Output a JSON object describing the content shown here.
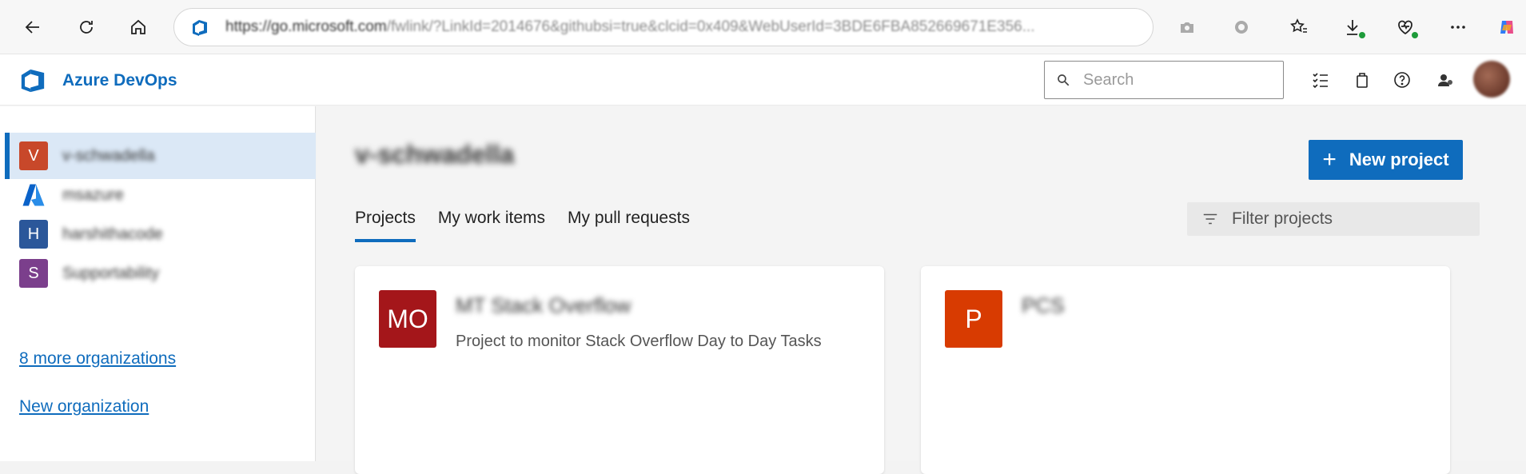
{
  "browser": {
    "url_host": "https://go.microsoft.com",
    "url_path": "/fwlink/?LinkId=2014676&githubsi=true&clcid=0x409&WebUserId=3BDE6FBA852669671E356..."
  },
  "app": {
    "name": "Azure DevOps",
    "search_placeholder": "Search"
  },
  "sidebar": {
    "organizations": [
      {
        "initial": "V",
        "name": "v-schwadella",
        "color": "#c8482a",
        "selected": true
      },
      {
        "initial": "",
        "name": "msazure",
        "color": "#0f6cbd",
        "selected": false
      },
      {
        "initial": "H",
        "name": "harshithacode",
        "color": "#2b579a",
        "selected": false
      },
      {
        "initial": "S",
        "name": "Supportability",
        "color": "#7b3f8c",
        "selected": false
      }
    ],
    "more_link": "8 more organizations",
    "new_org_link": "New organization"
  },
  "main": {
    "org_title": "v-schwadella",
    "new_project_label": "New project",
    "tabs": [
      {
        "label": "Projects",
        "active": true
      },
      {
        "label": "My work items",
        "active": false
      },
      {
        "label": "My pull requests",
        "active": false
      }
    ],
    "filter_placeholder": "Filter projects",
    "projects": [
      {
        "initials": "MO",
        "name": "MT Stack Overflow",
        "description": "Project to monitor Stack Overflow Day to Day Tasks",
        "color": "#a4161a"
      },
      {
        "initials": "P",
        "name": "PCS",
        "description": "",
        "color": "#d83b01"
      }
    ]
  }
}
